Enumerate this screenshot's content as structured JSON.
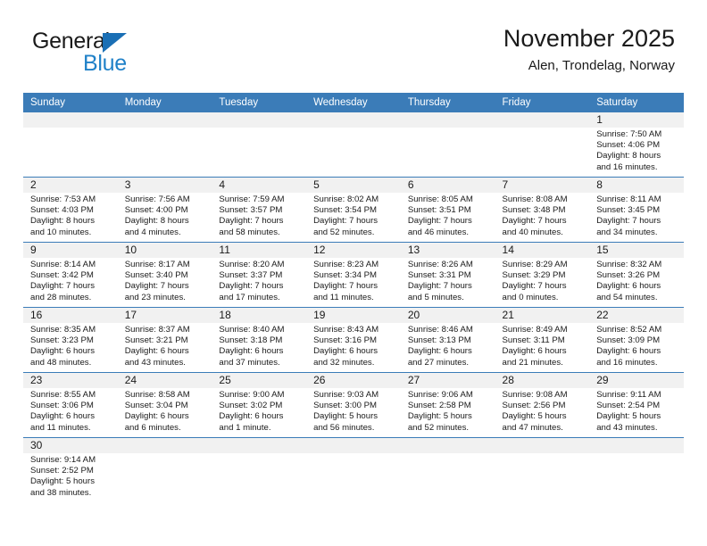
{
  "brand": {
    "name_top": "General",
    "name_bottom": "Blue",
    "accent_color": "#2081c8",
    "triangle_color": "#1a6fb5"
  },
  "header": {
    "title": "November 2025",
    "subtitle": "Alen, Trondelag, Norway"
  },
  "theme": {
    "header_blue": "#3b7cb8",
    "daynum_strip": "#f1f1f1",
    "text": "#1a1a1a"
  },
  "calendar": {
    "weekday_headers": [
      "Sunday",
      "Monday",
      "Tuesday",
      "Wednesday",
      "Thursday",
      "Friday",
      "Saturday"
    ],
    "weeks": [
      [
        {
          "day": "",
          "lines": []
        },
        {
          "day": "",
          "lines": []
        },
        {
          "day": "",
          "lines": []
        },
        {
          "day": "",
          "lines": []
        },
        {
          "day": "",
          "lines": []
        },
        {
          "day": "",
          "lines": []
        },
        {
          "day": "1",
          "lines": [
            "Sunrise: 7:50 AM",
            "Sunset: 4:06 PM",
            "Daylight: 8 hours",
            "and 16 minutes."
          ]
        }
      ],
      [
        {
          "day": "2",
          "lines": [
            "Sunrise: 7:53 AM",
            "Sunset: 4:03 PM",
            "Daylight: 8 hours",
            "and 10 minutes."
          ]
        },
        {
          "day": "3",
          "lines": [
            "Sunrise: 7:56 AM",
            "Sunset: 4:00 PM",
            "Daylight: 8 hours",
            "and 4 minutes."
          ]
        },
        {
          "day": "4",
          "lines": [
            "Sunrise: 7:59 AM",
            "Sunset: 3:57 PM",
            "Daylight: 7 hours",
            "and 58 minutes."
          ]
        },
        {
          "day": "5",
          "lines": [
            "Sunrise: 8:02 AM",
            "Sunset: 3:54 PM",
            "Daylight: 7 hours",
            "and 52 minutes."
          ]
        },
        {
          "day": "6",
          "lines": [
            "Sunrise: 8:05 AM",
            "Sunset: 3:51 PM",
            "Daylight: 7 hours",
            "and 46 minutes."
          ]
        },
        {
          "day": "7",
          "lines": [
            "Sunrise: 8:08 AM",
            "Sunset: 3:48 PM",
            "Daylight: 7 hours",
            "and 40 minutes."
          ]
        },
        {
          "day": "8",
          "lines": [
            "Sunrise: 8:11 AM",
            "Sunset: 3:45 PM",
            "Daylight: 7 hours",
            "and 34 minutes."
          ]
        }
      ],
      [
        {
          "day": "9",
          "lines": [
            "Sunrise: 8:14 AM",
            "Sunset: 3:42 PM",
            "Daylight: 7 hours",
            "and 28 minutes."
          ]
        },
        {
          "day": "10",
          "lines": [
            "Sunrise: 8:17 AM",
            "Sunset: 3:40 PM",
            "Daylight: 7 hours",
            "and 23 minutes."
          ]
        },
        {
          "day": "11",
          "lines": [
            "Sunrise: 8:20 AM",
            "Sunset: 3:37 PM",
            "Daylight: 7 hours",
            "and 17 minutes."
          ]
        },
        {
          "day": "12",
          "lines": [
            "Sunrise: 8:23 AM",
            "Sunset: 3:34 PM",
            "Daylight: 7 hours",
            "and 11 minutes."
          ]
        },
        {
          "day": "13",
          "lines": [
            "Sunrise: 8:26 AM",
            "Sunset: 3:31 PM",
            "Daylight: 7 hours",
            "and 5 minutes."
          ]
        },
        {
          "day": "14",
          "lines": [
            "Sunrise: 8:29 AM",
            "Sunset: 3:29 PM",
            "Daylight: 7 hours",
            "and 0 minutes."
          ]
        },
        {
          "day": "15",
          "lines": [
            "Sunrise: 8:32 AM",
            "Sunset: 3:26 PM",
            "Daylight: 6 hours",
            "and 54 minutes."
          ]
        }
      ],
      [
        {
          "day": "16",
          "lines": [
            "Sunrise: 8:35 AM",
            "Sunset: 3:23 PM",
            "Daylight: 6 hours",
            "and 48 minutes."
          ]
        },
        {
          "day": "17",
          "lines": [
            "Sunrise: 8:37 AM",
            "Sunset: 3:21 PM",
            "Daylight: 6 hours",
            "and 43 minutes."
          ]
        },
        {
          "day": "18",
          "lines": [
            "Sunrise: 8:40 AM",
            "Sunset: 3:18 PM",
            "Daylight: 6 hours",
            "and 37 minutes."
          ]
        },
        {
          "day": "19",
          "lines": [
            "Sunrise: 8:43 AM",
            "Sunset: 3:16 PM",
            "Daylight: 6 hours",
            "and 32 minutes."
          ]
        },
        {
          "day": "20",
          "lines": [
            "Sunrise: 8:46 AM",
            "Sunset: 3:13 PM",
            "Daylight: 6 hours",
            "and 27 minutes."
          ]
        },
        {
          "day": "21",
          "lines": [
            "Sunrise: 8:49 AM",
            "Sunset: 3:11 PM",
            "Daylight: 6 hours",
            "and 21 minutes."
          ]
        },
        {
          "day": "22",
          "lines": [
            "Sunrise: 8:52 AM",
            "Sunset: 3:09 PM",
            "Daylight: 6 hours",
            "and 16 minutes."
          ]
        }
      ],
      [
        {
          "day": "23",
          "lines": [
            "Sunrise: 8:55 AM",
            "Sunset: 3:06 PM",
            "Daylight: 6 hours",
            "and 11 minutes."
          ]
        },
        {
          "day": "24",
          "lines": [
            "Sunrise: 8:58 AM",
            "Sunset: 3:04 PM",
            "Daylight: 6 hours",
            "and 6 minutes."
          ]
        },
        {
          "day": "25",
          "lines": [
            "Sunrise: 9:00 AM",
            "Sunset: 3:02 PM",
            "Daylight: 6 hours",
            "and 1 minute."
          ]
        },
        {
          "day": "26",
          "lines": [
            "Sunrise: 9:03 AM",
            "Sunset: 3:00 PM",
            "Daylight: 5 hours",
            "and 56 minutes."
          ]
        },
        {
          "day": "27",
          "lines": [
            "Sunrise: 9:06 AM",
            "Sunset: 2:58 PM",
            "Daylight: 5 hours",
            "and 52 minutes."
          ]
        },
        {
          "day": "28",
          "lines": [
            "Sunrise: 9:08 AM",
            "Sunset: 2:56 PM",
            "Daylight: 5 hours",
            "and 47 minutes."
          ]
        },
        {
          "day": "29",
          "lines": [
            "Sunrise: 9:11 AM",
            "Sunset: 2:54 PM",
            "Daylight: 5 hours",
            "and 43 minutes."
          ]
        }
      ],
      [
        {
          "day": "30",
          "lines": [
            "Sunrise: 9:14 AM",
            "Sunset: 2:52 PM",
            "Daylight: 5 hours",
            "and 38 minutes."
          ]
        },
        {
          "day": "",
          "lines": []
        },
        {
          "day": "",
          "lines": []
        },
        {
          "day": "",
          "lines": []
        },
        {
          "day": "",
          "lines": []
        },
        {
          "day": "",
          "lines": []
        },
        {
          "day": "",
          "lines": []
        }
      ]
    ]
  }
}
